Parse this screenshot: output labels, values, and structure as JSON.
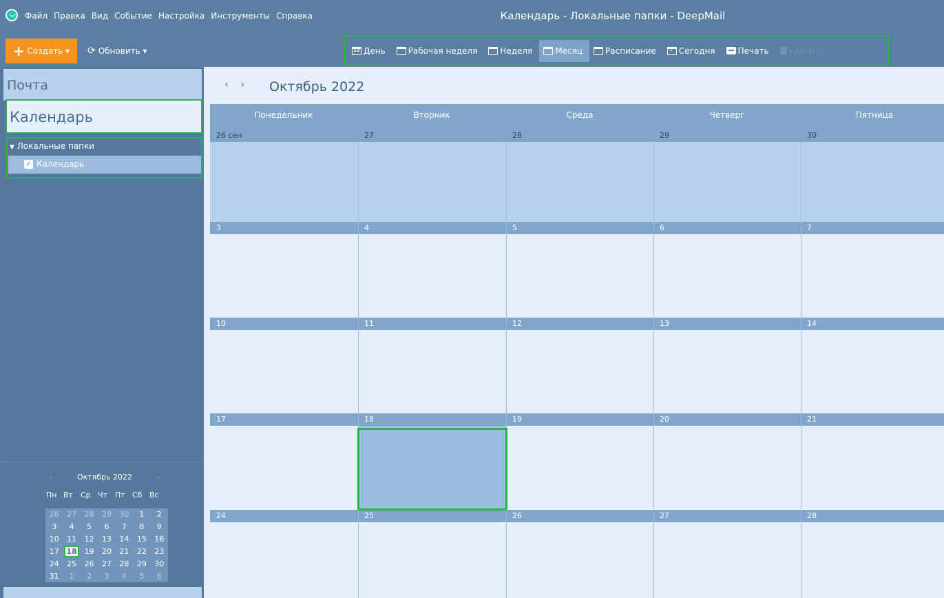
{
  "window": {
    "title": "Календарь - Локальные папки - DeepMail",
    "menu": [
      "Файл",
      "Правка",
      "Вид",
      "Событие",
      "Настройка",
      "Инструменты",
      "Справка"
    ]
  },
  "toolbar": {
    "create_label": "Создать ▾",
    "refresh_label": "Обновить ▾",
    "views": [
      {
        "label": "День",
        "icon": "calendar-day-icon"
      },
      {
        "label": "Рабочая неделя",
        "icon": "calendar-workweek-icon"
      },
      {
        "label": "Неделя",
        "icon": "calendar-week-icon"
      },
      {
        "label": "Месяц",
        "icon": "calendar-month-icon",
        "active": true
      },
      {
        "label": "Расписание",
        "icon": "calendar-schedule-icon"
      },
      {
        "label": "Сегодня",
        "icon": "calendar-today-icon"
      },
      {
        "label": "Печать",
        "icon": "printer-icon"
      },
      {
        "label": "Удалить",
        "icon": "trash-icon",
        "disabled": true
      }
    ]
  },
  "sidebar": {
    "mail_label": "Почта",
    "calendar_label": "Календарь",
    "folders_label": "Локальные папки",
    "calendar_item_label": "Календарь",
    "mini_calendar": {
      "title": "Октябрь 2022",
      "weekdays": [
        "Пн",
        "Вт",
        "Ср",
        "Чт",
        "Пт",
        "Сб",
        "Вс"
      ],
      "weeks": [
        [
          "26",
          "27",
          "28",
          "29",
          "30",
          "1",
          "2"
        ],
        [
          "3",
          "4",
          "5",
          "6",
          "7",
          "8",
          "9"
        ],
        [
          "10",
          "11",
          "12",
          "13",
          "14",
          "15",
          "16"
        ],
        [
          "17",
          "18",
          "19",
          "20",
          "21",
          "22",
          "23"
        ],
        [
          "24",
          "25",
          "26",
          "27",
          "28",
          "29",
          "30"
        ],
        [
          "31",
          "1",
          "2",
          "3",
          "4",
          "5",
          "6"
        ]
      ],
      "today": "18"
    }
  },
  "main": {
    "month_title": "Октябрь 2022",
    "weekdays": [
      "Понедельник",
      "Вторник",
      "Среда",
      "Четверг",
      "Пятница"
    ],
    "weeks": [
      [
        "26 сен",
        "27",
        "28",
        "29",
        "30"
      ],
      [
        "3",
        "4",
        "5",
        "6",
        "7"
      ],
      [
        "10",
        "11",
        "12",
        "13",
        "14"
      ],
      [
        "17",
        "18",
        "19",
        "20",
        "21"
      ],
      [
        "24",
        "25",
        "26",
        "27",
        "28"
      ]
    ]
  },
  "colors": {
    "accent": "#f5941d",
    "header": "#5b7fa3",
    "selection": "#2eb24a"
  }
}
